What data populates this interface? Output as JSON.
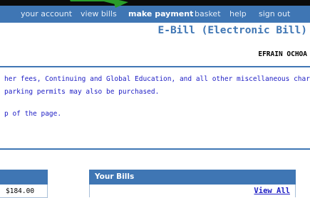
{
  "nav": {
    "items": [
      {
        "label": "your account"
      },
      {
        "label": "view bills"
      },
      {
        "label": "make payment"
      },
      {
        "label": "basket"
      },
      {
        "label": "help"
      },
      {
        "label": "sign out"
      }
    ],
    "active_item": "make payment"
  },
  "header": {
    "title": "E-Bill (Electronic Bill)",
    "user_name": "EFRAIN OCHOA"
  },
  "info": {
    "line1": "her fees, Continuing and Global Education, and all other miscellaneous charges",
    "line2": "parking permits may also be purchased.",
    "line3": "p of the page."
  },
  "left_panel": {
    "amount": "$184.00"
  },
  "bills_panel": {
    "title": "Your Bills",
    "view_all": "View All"
  },
  "colors": {
    "nav_blue": "#3f76b4",
    "link_blue": "#1c1cc4",
    "arrow_green": "#2a9d2a"
  },
  "icons": {
    "arrow": "green-arrow-pointing-to-make-payment"
  }
}
